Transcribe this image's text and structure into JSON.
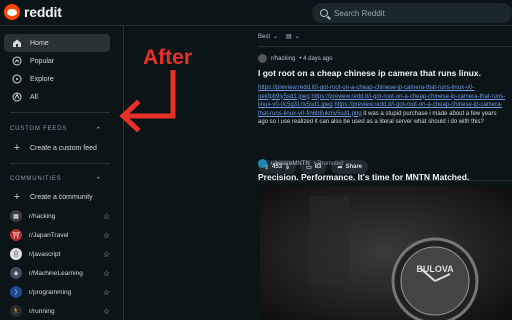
{
  "header": {
    "brand": "reddit",
    "search_placeholder": "Search Reddit"
  },
  "sidebar": {
    "nav": [
      {
        "label": "Home",
        "icon": "home-icon"
      },
      {
        "label": "Popular",
        "icon": "popular-icon"
      },
      {
        "label": "Explore",
        "icon": "explore-icon"
      },
      {
        "label": "All",
        "icon": "all-icon"
      }
    ],
    "custom_feeds": {
      "heading": "CUSTOM FEEDS",
      "create_label": "Create a custom feed"
    },
    "communities": {
      "heading": "COMMUNITIES",
      "create_label": "Create a community",
      "items": [
        {
          "name": "r/hacking",
          "color": "#3a3a3a"
        },
        {
          "name": "r/JapanTravel",
          "color": "#b32c2c"
        },
        {
          "name": "r/javascript",
          "color": "#e0e0e0"
        },
        {
          "name": "r/MachineLearning",
          "color": "#3d4c5a"
        },
        {
          "name": "r/programming",
          "color": "#1c4b8f"
        },
        {
          "name": "r/running",
          "color": "#2b2b2b"
        }
      ]
    }
  },
  "annotation": {
    "text": "After",
    "color": "#e8302a"
  },
  "feed": {
    "sort_label": "Best",
    "posts": [
      {
        "subreddit": "r/hacking",
        "time": "• 4 days ago",
        "title": "I got root on a cheap chinese ip camera that runs linux.",
        "link1": "https://preview.redd.it/i-got-root-on-a-cheap-chinese-ip-camera-that-runs-linux-v0-oekfpb9ly5sd1.jpeg",
        "link2": "https://preview.redd.it/i-got-root-on-a-cheap-chinese-ip-camera-that-runs-linux-v0-0c5g31rlv5sd1.jpeg",
        "link3": "https://preview.redd.it/i-got-root-on-a-cheap-chinese-ip-camera-that-runs-linux-v0-fin6b8ukmv5sd1.png",
        "text": " it was a stupid purchase i made about a few years ago so i use realized it can also be used as a literal server what should i do with this?",
        "votes": "453",
        "comments": "83",
        "share_label": "Share"
      },
      {
        "subreddit": "u/weareMNTN",
        "promoted": "• Promoted",
        "title": "Precision. Performance. It's time for MNTN Matched."
      }
    ]
  }
}
